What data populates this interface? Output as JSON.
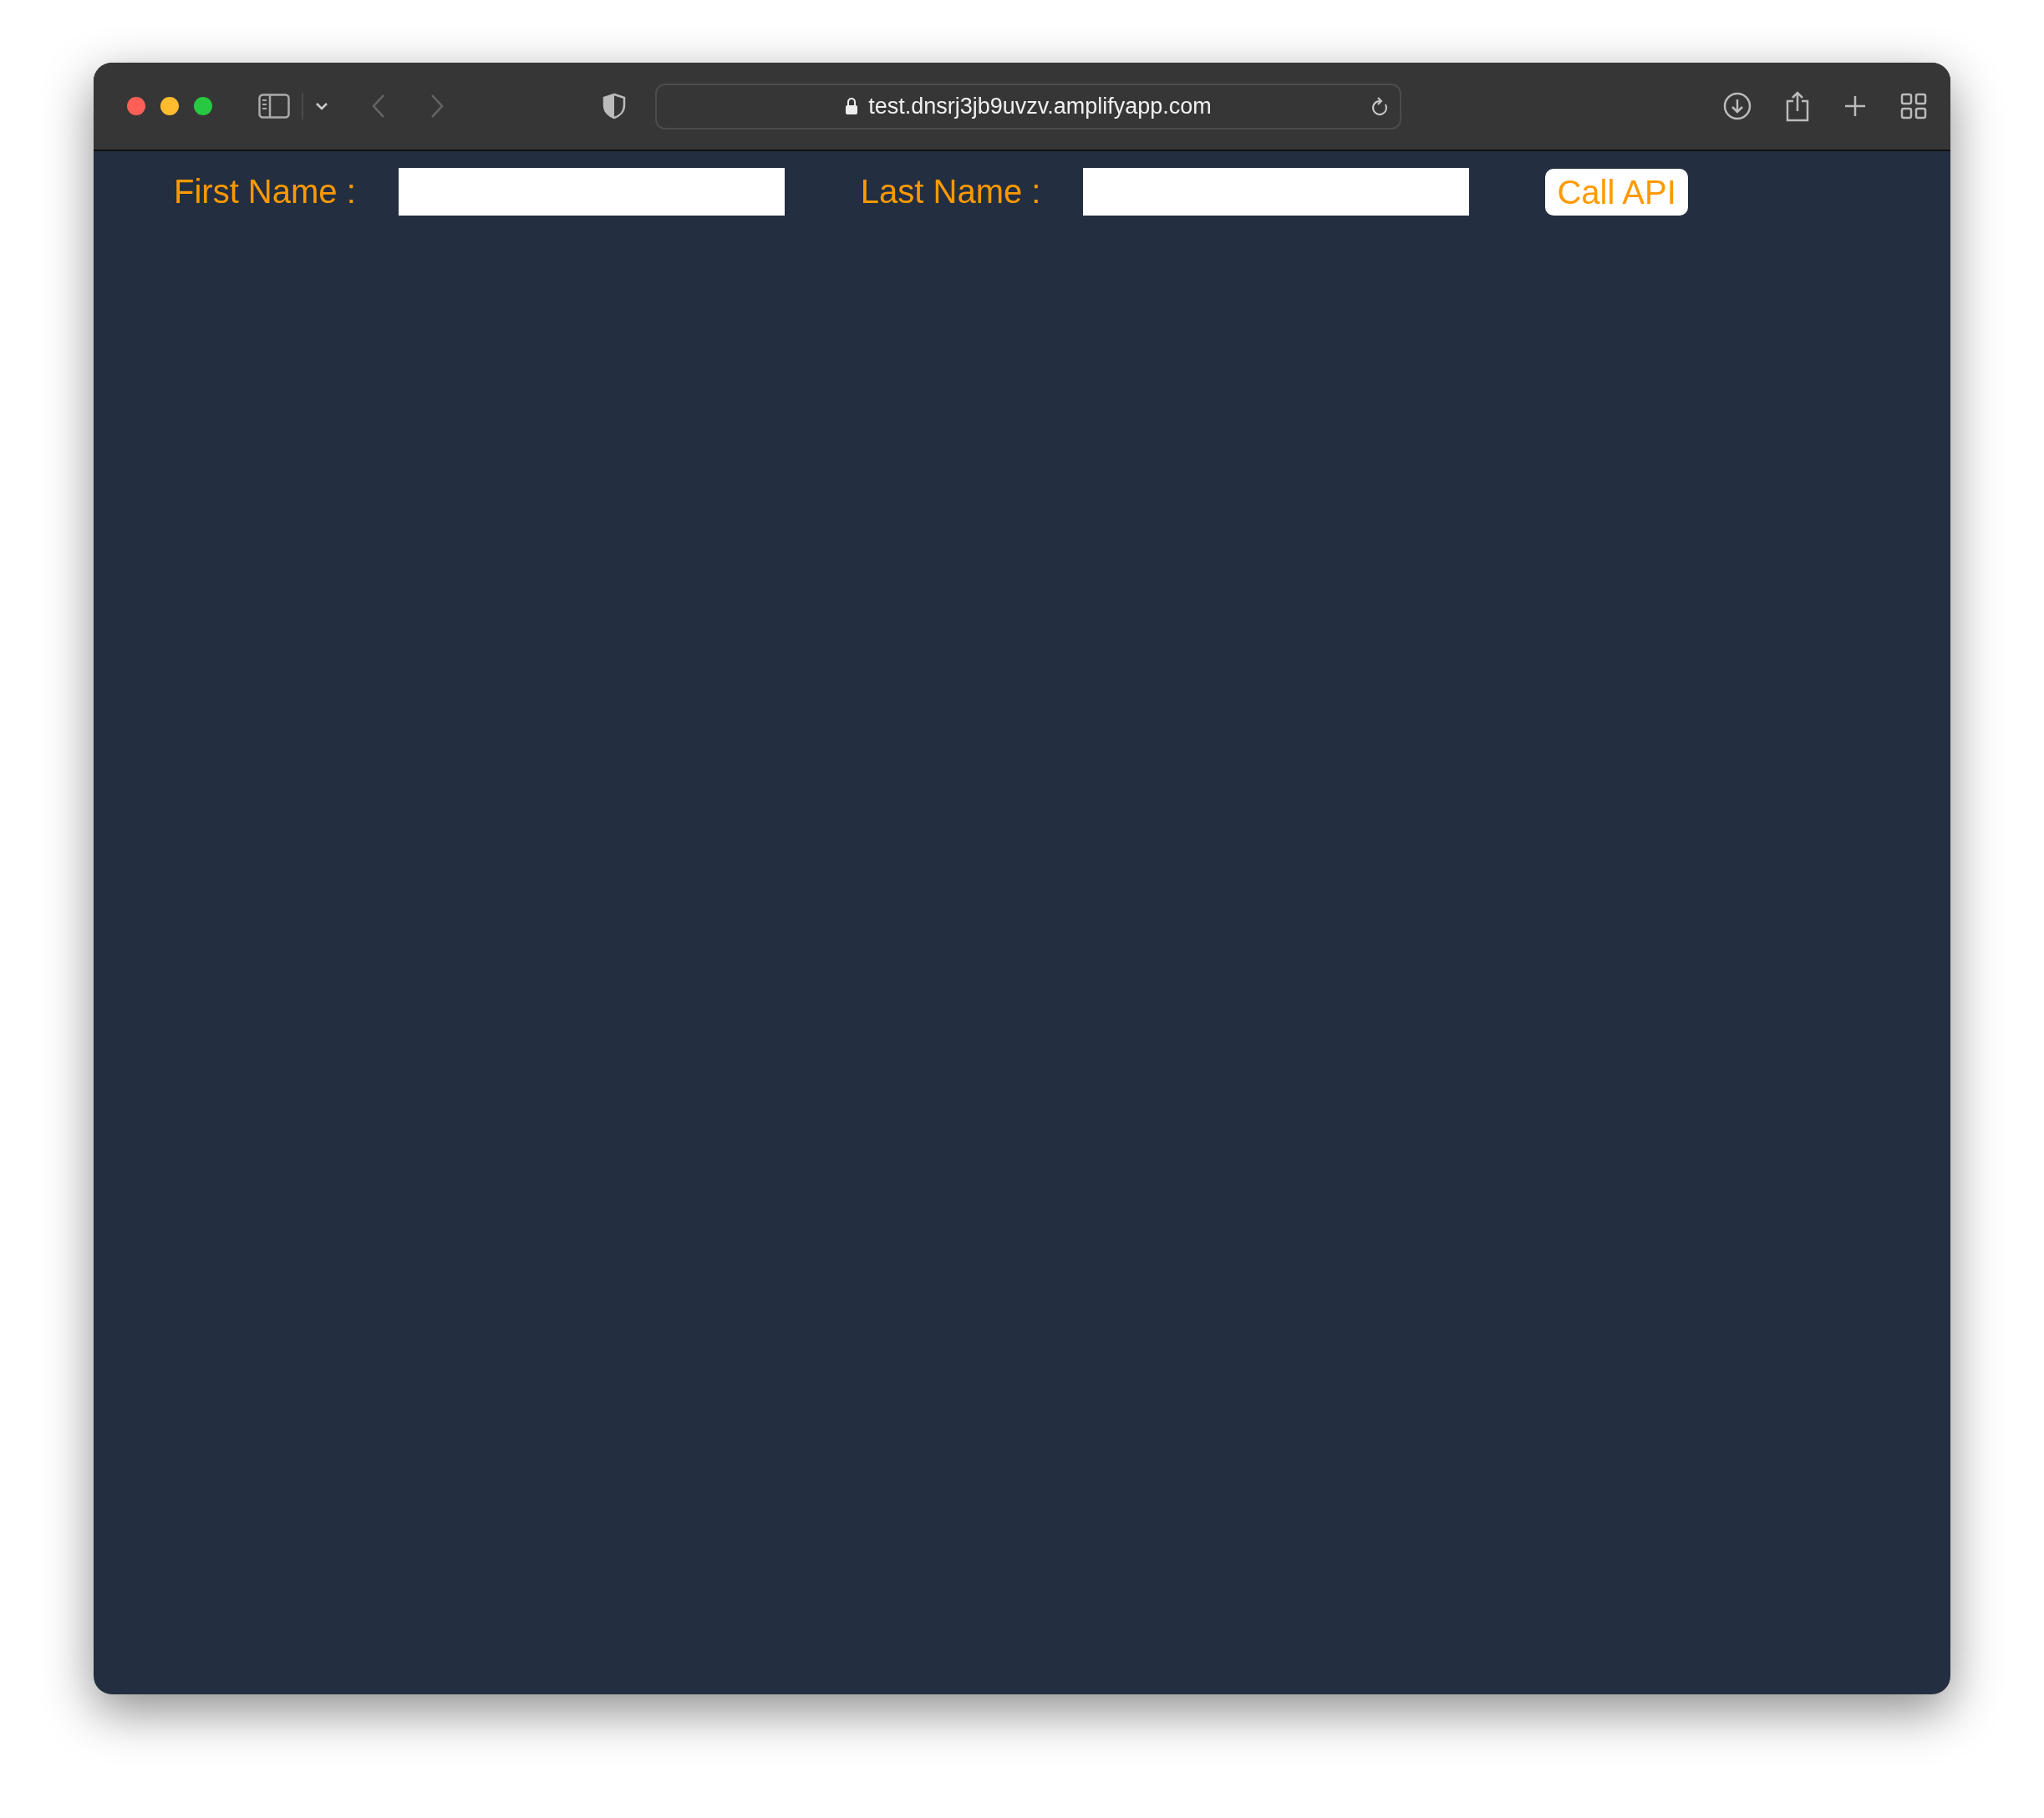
{
  "browser": {
    "url": "test.dnsrj3jb9uvzv.amplifyapp.com"
  },
  "form": {
    "fields": [
      {
        "label": "First Name :"
      },
      {
        "label": "Last Name :"
      }
    ],
    "button": "Call API"
  }
}
